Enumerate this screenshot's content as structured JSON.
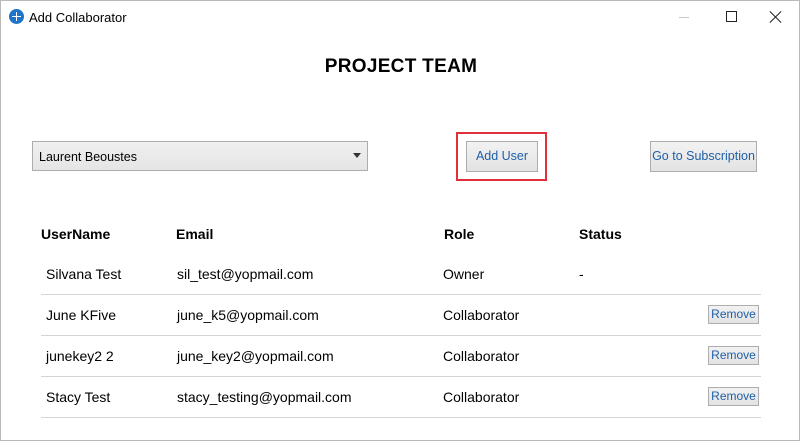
{
  "window": {
    "title": "Add Collaborator"
  },
  "page": {
    "title": "PROJECT TEAM"
  },
  "controls": {
    "dropdown_value": "Laurent Beoustes",
    "add_user_label": "Add User",
    "subscription_label": "Go to Subscription"
  },
  "table": {
    "headers": {
      "username": "UserName",
      "email": "Email",
      "role": "Role",
      "status": "Status"
    },
    "rows": [
      {
        "username": "Silvana Test",
        "email": "sil_test@yopmail.com",
        "role": "Owner",
        "status": "-",
        "action": ""
      },
      {
        "username": "June KFive",
        "email": "june_k5@yopmail.com",
        "role": "Collaborator",
        "status": "",
        "action": "Remove"
      },
      {
        "username": "junekey2 2",
        "email": "june_key2@yopmail.com",
        "role": "Collaborator",
        "status": "",
        "action": "Remove"
      },
      {
        "username": "Stacy Test",
        "email": "stacy_testing@yopmail.com",
        "role": "Collaborator",
        "status": "",
        "action": "Remove"
      }
    ]
  },
  "colors": {
    "highlight": "#e0303a",
    "link_text": "#1f5fa8",
    "app_icon": "#1f74c9"
  },
  "icons": {
    "app": "app-icon",
    "minimize": "minimize-icon",
    "maximize": "maximize-icon",
    "close": "close-icon",
    "dropdown": "chevron-down-icon"
  }
}
